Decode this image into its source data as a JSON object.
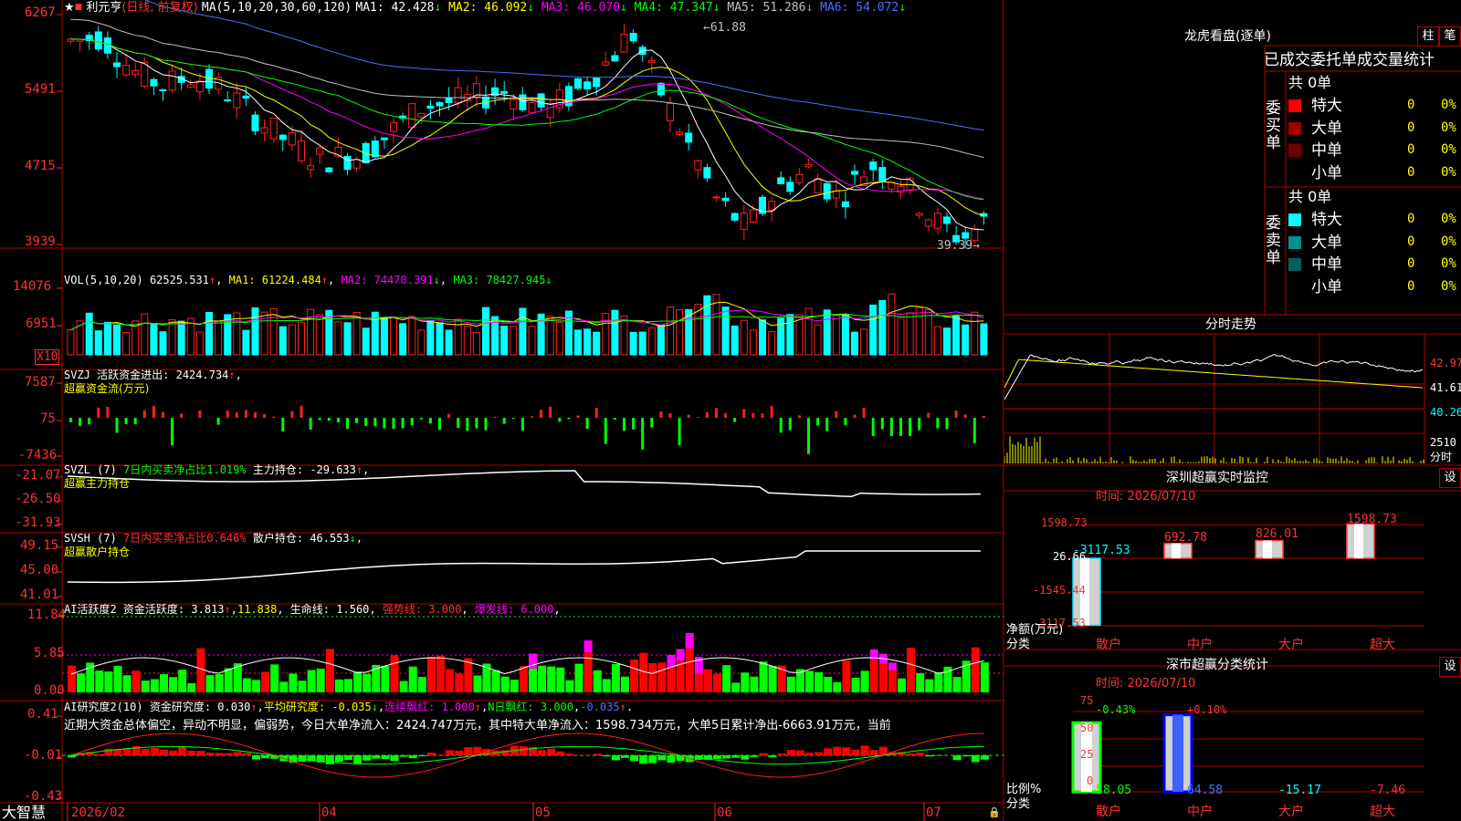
{
  "main_chart": {
    "stock_name": "利元亨",
    "mode": "(日线, 前复权)",
    "ma_prefix": "MA(5,10,20,30,60,120)",
    "ma_items": [
      {
        "label": "MA1:",
        "value": "42.428",
        "arrow": "↓",
        "color": "#ffffff"
      },
      {
        "label": "MA2:",
        "value": "46.092",
        "arrow": "↓",
        "color": "#ffff00"
      },
      {
        "label": "MA3:",
        "value": "46.070",
        "arrow": "↓",
        "color": "#ff00ff"
      },
      {
        "label": "MA4:",
        "value": "47.347",
        "arrow": "↓",
        "color": "#00ff00"
      },
      {
        "label": "MA5:",
        "value": "51.286",
        "arrow": "↓",
        "color": "#c0c0c0"
      },
      {
        "label": "MA6:",
        "value": "54.072",
        "arrow": "↓",
        "color": "#4a70ff"
      }
    ],
    "y_labels": [
      "6267",
      "5491",
      "4715",
      "3939"
    ],
    "high_label": "61.88",
    "low_label": "39.39"
  },
  "volume": {
    "title": "VOL(5,10,20)",
    "value": "62525.531",
    "ma1": "61224.484",
    "ma2": "74470.391",
    "ma3": "78427.945",
    "y_labels": [
      "14076",
      "6951"
    ],
    "unit": "X10"
  },
  "svzj": {
    "title": "SVZJ",
    "label": "活跃资金进出:",
    "value": "2424.734",
    "subtitle": "超赢资金流(万元)",
    "y_labels": [
      "7587",
      "75",
      "-7436"
    ]
  },
  "svzl": {
    "title": "SVZL (7)",
    "desc": "7日内买卖净占比1.019%",
    "label": "主力持仓:",
    "value": "-29.633",
    "subtitle": "超赢主力持仓",
    "y_labels": [
      "-21.07",
      "-26.50",
      "-31.93"
    ]
  },
  "svsh": {
    "title": "SVSH (7)",
    "desc": "7日内买卖净占比0.646%",
    "label": "散户持仓:",
    "value": "46.553",
    "subtitle": "超赢散户持仓",
    "y_labels": [
      "49.15",
      "45.00",
      "41.01"
    ]
  },
  "ai_active": {
    "title": "AI活跃度2",
    "label": "资金活跃度:",
    "value": "3.813",
    "v2": "11.838",
    "life_label": "生命线:",
    "life": "1.560",
    "strong": "强势线: 3.000",
    "burst": "爆发线: 6.000",
    "y_labels": [
      "11.84",
      "5.85",
      "0.00"
    ]
  },
  "ai_research": {
    "title": "AI研究度2(10)",
    "label": "资金研究度:",
    "value": "0.030",
    "avg": "平均研究度: -0.035",
    "cont": "连续飘红: 1.000",
    "nday": "N日飘红: 3.000",
    "last": "-0.035",
    "comment": "近期大资金总体偏空，异动不明显，偏弱势，今日大单净流入：2424.747万元，其中特大单净流入：1598.734万元，大单5日累计净出-6663.91万元，当前",
    "y_labels": [
      "0.41",
      "-0.01",
      "-0.43"
    ]
  },
  "date_axis": {
    "brand": "大智慧",
    "labels": [
      "2026/02",
      "04",
      "05",
      "06",
      "07"
    ]
  },
  "right_panel": {
    "dragon_title": "龙虎看盘(逐单)",
    "btn_bar": "柱",
    "btn_pen": "笔",
    "stat_title": "已成交委托单成交量统计",
    "buy_label": "委买单",
    "sell_label": "委卖单",
    "buy_total": "共 0单",
    "sell_total": "共 0单",
    "buy_rows": [
      {
        "name": "特大",
        "count": "0",
        "pct": "0%",
        "color": "#ff0000"
      },
      {
        "name": "大单",
        "count": "0",
        "pct": "0%",
        "color": "#a00000"
      },
      {
        "name": "中单",
        "count": "0",
        "pct": "0%",
        "color": "#700000"
      },
      {
        "name": "小单",
        "count": "0",
        "pct": "0%",
        "color": "#000000"
      }
    ],
    "sell_rows": [
      {
        "name": "特大",
        "count": "0",
        "pct": "0%",
        "color": "#00ffff"
      },
      {
        "name": "大单",
        "count": "0",
        "pct": "0%",
        "color": "#009090"
      },
      {
        "name": "中单",
        "count": "0",
        "pct": "0%",
        "color": "#006060"
      },
      {
        "name": "小单",
        "count": "0",
        "pct": "0%",
        "color": "#000000"
      }
    ],
    "intraday_title": "分时走势",
    "intraday_prices": [
      "42.97",
      "41.61",
      "40.26"
    ],
    "intraday_vol": "2510",
    "intraday_vol_label": "分时",
    "monitor_title": "深圳超赢实时监控",
    "monitor_btn": "设",
    "monitor_time": "时间: 2026/07/10",
    "monitor_y": [
      "1598.73",
      "26.66",
      "-1545.44",
      "-3117.53"
    ],
    "monitor_axis_label": "净额(万元)",
    "monitor_cat_label": "分类",
    "monitor_values": [
      {
        "cat": "散户",
        "value": "-3117.53",
        "num": -3117.53
      },
      {
        "cat": "中户",
        "value": "692.78",
        "num": 692.78
      },
      {
        "cat": "大户",
        "value": "826.01",
        "num": 826.01
      },
      {
        "cat": "超大",
        "value": "1598.73",
        "num": 1598.73
      }
    ],
    "class_title": "深市超赢分类统计",
    "class_btn": "设",
    "class_time": "时间: 2026/07/10",
    "class_y": [
      "75",
      "50",
      "25",
      "0"
    ],
    "class_ratio_label": "比例%",
    "class_cat_label": "分类",
    "class_values": [
      {
        "cat": "散户",
        "ratio": "58.05",
        "change": "-0.43%",
        "num": 58.05
      },
      {
        "cat": "中户",
        "ratio": "64.58",
        "change": "+0.10%",
        "num": 64.58
      },
      {
        "cat": "大户",
        "ratio": "-15.17",
        "change": "",
        "num": -15.17
      },
      {
        "cat": "超大",
        "ratio": "-7.46",
        "change": "",
        "num": -7.46
      }
    ]
  }
}
